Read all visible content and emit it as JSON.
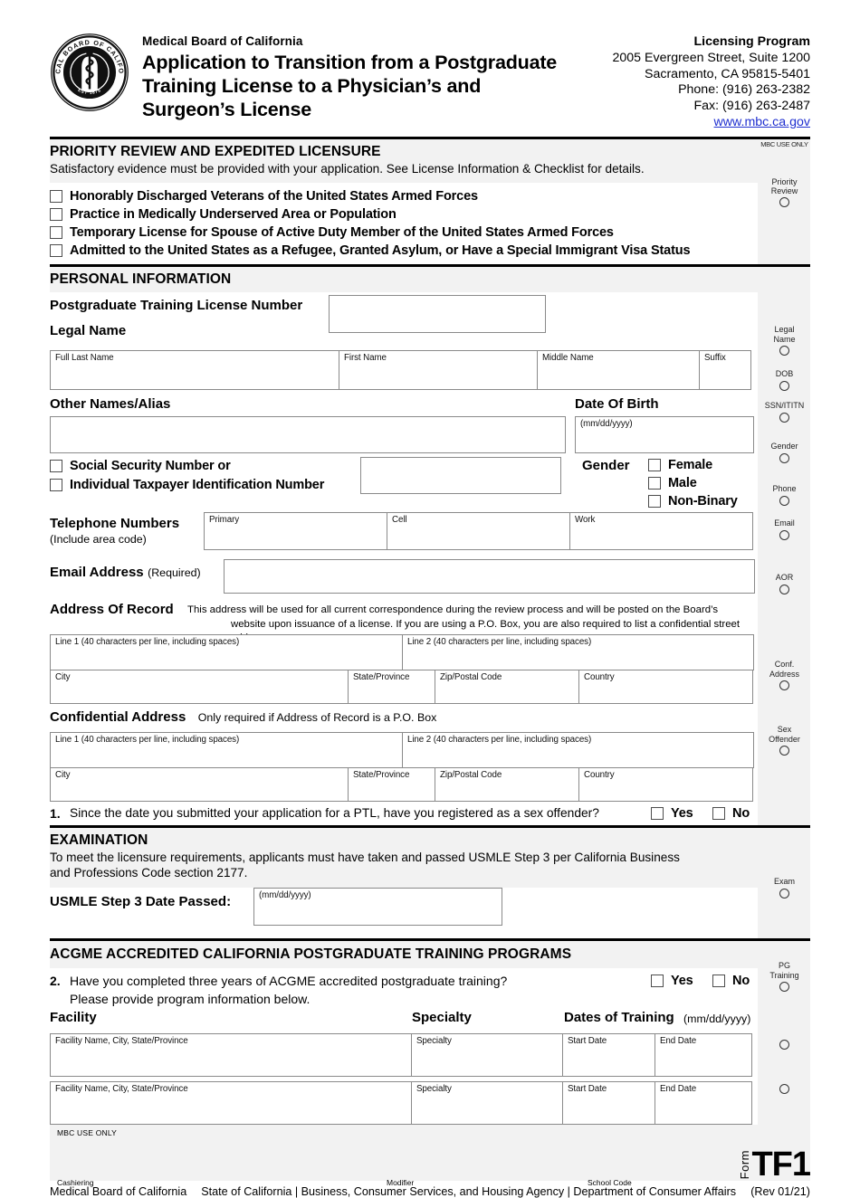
{
  "header": {
    "org_name": "Medical Board of California",
    "form_title_lines": [
      "Application to Transition from a Postgraduate",
      "Training License to a Physician’s and",
      "Surgeon’s License"
    ],
    "logo_alt": "medical-board-of-california-seal",
    "contact": {
      "program": "Licensing Program",
      "street": "2005 Evergreen Street, Suite 1200",
      "city_state_zip": "Sacramento, CA 95815-5401",
      "phone": "Phone: (916) 263-2382",
      "fax": "Fax: (916) 263-2487",
      "url": "www.mbc.ca.gov",
      "url_color": "#2a3ad0"
    }
  },
  "mbc_use_only_label": "MBC USE ONLY",
  "priority": {
    "title": "PRIORITY REVIEW AND EXPEDITED LICENSURE",
    "subtitle": "Satisfactory evidence must be provided with your application. See License Information & Checklist for details.",
    "options": [
      "Honorably Discharged Veterans of the United States Armed Forces",
      "Practice in Medically Underserved Area or Population",
      "Temporary License for Spouse of Active Duty Member of the United States Armed Forces",
      "Admitted to the United States as a Refugee, Granted Asylum, or Have a Special Immigrant Visa Status"
    ],
    "side_label_line1": "Priority",
    "side_label_line2": "Review"
  },
  "personal": {
    "title": "PERSONAL INFORMATION",
    "ptl_number_label": "Postgraduate Training License Number",
    "legal_name_label": "Legal Name",
    "legal_name_cells": [
      "Full Last Name",
      "First Name",
      "Middle Name",
      "Suffix"
    ],
    "other_names_label": "Other Names/Alias",
    "dob_label": "Date Of Birth",
    "dob_hint": "(mm/dd/yyyy)",
    "ssn_label": "Social Security Number or",
    "itin_label": "Individual Taxpayer Identification Number",
    "gender_label": "Gender",
    "gender_options": [
      "Female",
      "Male",
      "Non-Binary"
    ],
    "telephone_label": "Telephone Numbers",
    "telephone_sub": "(Include area code)",
    "phone_cells": [
      "Primary",
      "Cell",
      "Work"
    ],
    "email_label": "Email Address",
    "email_required": "(Required)",
    "aor_label": "Address Of Record",
    "aor_note_line1": "This address will be used for all current correspondence during the review process and will be posted on the Board’s",
    "aor_note_line2": "website upon issuance of a license. If you are using a P.O. Box, you are also required to list a confidential street address.",
    "addr_line1_hint": "Line 1 (40 characters per line, including spaces)",
    "addr_line2_hint": "Line 2 (40 characters per line, including spaces)",
    "addr_city_hint": "City",
    "addr_state_hint": "State/Province",
    "addr_zip_hint": "Zip/Postal Code",
    "addr_country_hint": "Country",
    "conf_label": "Confidential Address",
    "conf_note": "Only required if Address of Record is a P.O. Box",
    "q1_number": "1.",
    "q1_text": "Since the date you submitted your application for a PTL, have you registered as a sex offender?",
    "yes_label": "Yes",
    "no_label": "No",
    "side_labels": {
      "legal_name": [
        "Legal",
        "Name"
      ],
      "dob": [
        "DOB"
      ],
      "ssn": [
        "SSN/ITITN"
      ],
      "gender": [
        "Gender"
      ],
      "phone": [
        "Phone"
      ],
      "email": [
        "Email"
      ],
      "aor": [
        "AOR"
      ],
      "conf_address": [
        "Conf.",
        "Address"
      ],
      "sex_offender": [
        "Sex",
        "Offender"
      ]
    }
  },
  "examination": {
    "title": "EXAMINATION",
    "body_line1": "To meet the licensure requirements, applicants must have taken and passed USMLE Step 3 per California Business",
    "body_line2": "and Professions Code section 2177.",
    "date_label": "USMLE Step 3 Date Passed:",
    "date_hint": "(mm/dd/yyyy)",
    "side_label": "Exam"
  },
  "acgme": {
    "title": "ACGME ACCREDITED CALIFORNIA POSTGRADUATE TRAINING PROGRAMS",
    "q2_number": "2.",
    "q2_line1": "Have you completed three years of ACGME accredited postgraduate training?",
    "q2_line2": "Please provide program information below.",
    "yes_label": "Yes",
    "no_label": "No",
    "col_facility": "Facility",
    "col_specialty": "Specialty",
    "col_dates": "Dates of Training",
    "col_dates_hint": "(mm/dd/yyyy)",
    "row_hints": {
      "facility": "Facility Name, City, State/Province",
      "specialty": "Specialty",
      "start": "Start Date",
      "end": "End Date"
    },
    "rows": [
      {
        "facility": "",
        "specialty": "",
        "start": "",
        "end": ""
      },
      {
        "facility": "",
        "specialty": "",
        "start": "",
        "end": ""
      }
    ],
    "side_label_line1": "PG",
    "side_label_line2": "Training"
  },
  "footer": {
    "mbc_use_only": "MBC USE ONLY",
    "cashiering": "Cashiering",
    "modifier": "Modifier",
    "school_code": "School Code",
    "form_word": "Form",
    "form_code": "TF1",
    "agency_left": "Medical Board of California",
    "agency_center": "State of California  |  Business, Consumer Services, and Housing Agency  |  Department of Consumer Affairs",
    "revision": "(Rev 01/21)"
  }
}
